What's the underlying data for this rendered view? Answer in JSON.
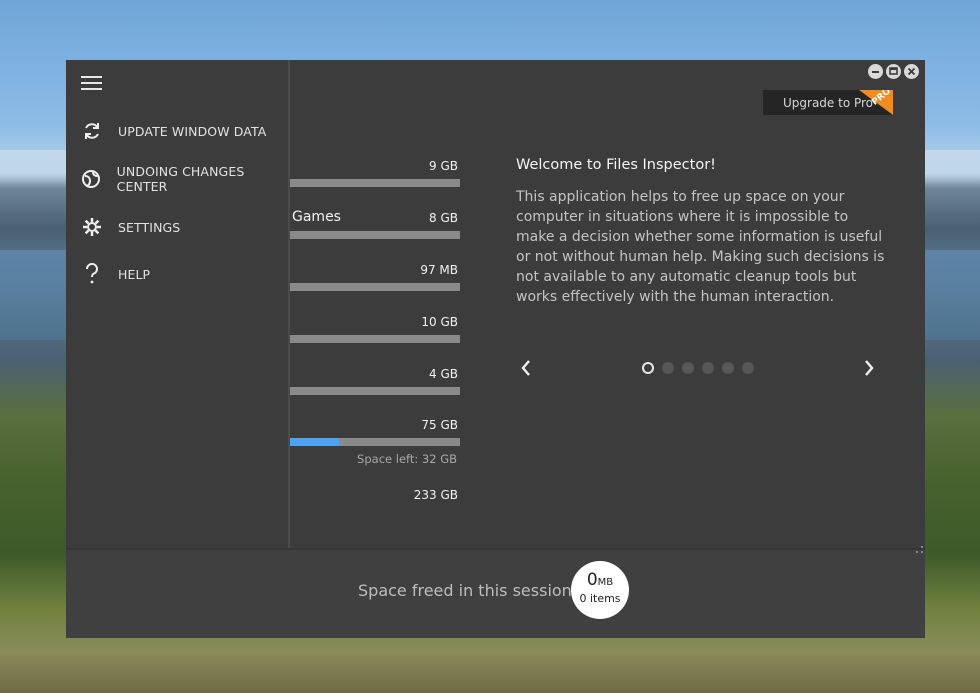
{
  "sidebar": {
    "items": [
      {
        "label": "UPDATE WINDOW DATA",
        "icon": "refresh-icon"
      },
      {
        "label": "UNDOING CHANGES CENTER",
        "icon": "undo-globe-icon"
      },
      {
        "label": "SETTINGS",
        "icon": "gear-icon"
      },
      {
        "label": "HELP",
        "icon": "question-icon"
      }
    ]
  },
  "drives": [
    {
      "name": "",
      "size": "9 GB",
      "fill": 0
    },
    {
      "name": "Games",
      "size": "8 GB",
      "fill": 0
    },
    {
      "name": "",
      "size": "97 MB",
      "fill": 0
    },
    {
      "name": "",
      "size": "10 GB",
      "fill": 0
    },
    {
      "name": "",
      "size": "4 GB",
      "fill": 0
    },
    {
      "name": "",
      "size": "75 GB",
      "fill": 0.29,
      "space_left": "Space left: 32 GB"
    },
    {
      "name": "",
      "size": "233 GB"
    }
  ],
  "upgrade": {
    "label": "Upgrade to Pro",
    "badge": "PRO"
  },
  "welcome": {
    "title": "Welcome to Files Inspector!",
    "body": "This application helps to free up space on your computer in situations where it is impossible to make a decision whether some information is useful or not without human help. Making such decisions is not available to any automatic cleanup tools but works effectively with the human interaction."
  },
  "carousel": {
    "total": 6,
    "active": 0
  },
  "footer": {
    "label": "Space freed in this session:",
    "freed_value": "0",
    "freed_unit": "MB",
    "freed_items": "0 items"
  },
  "colors": {
    "accent": "#4da3f0",
    "pro_badge": "#f28c1e",
    "panel": "#3c3c3c"
  }
}
